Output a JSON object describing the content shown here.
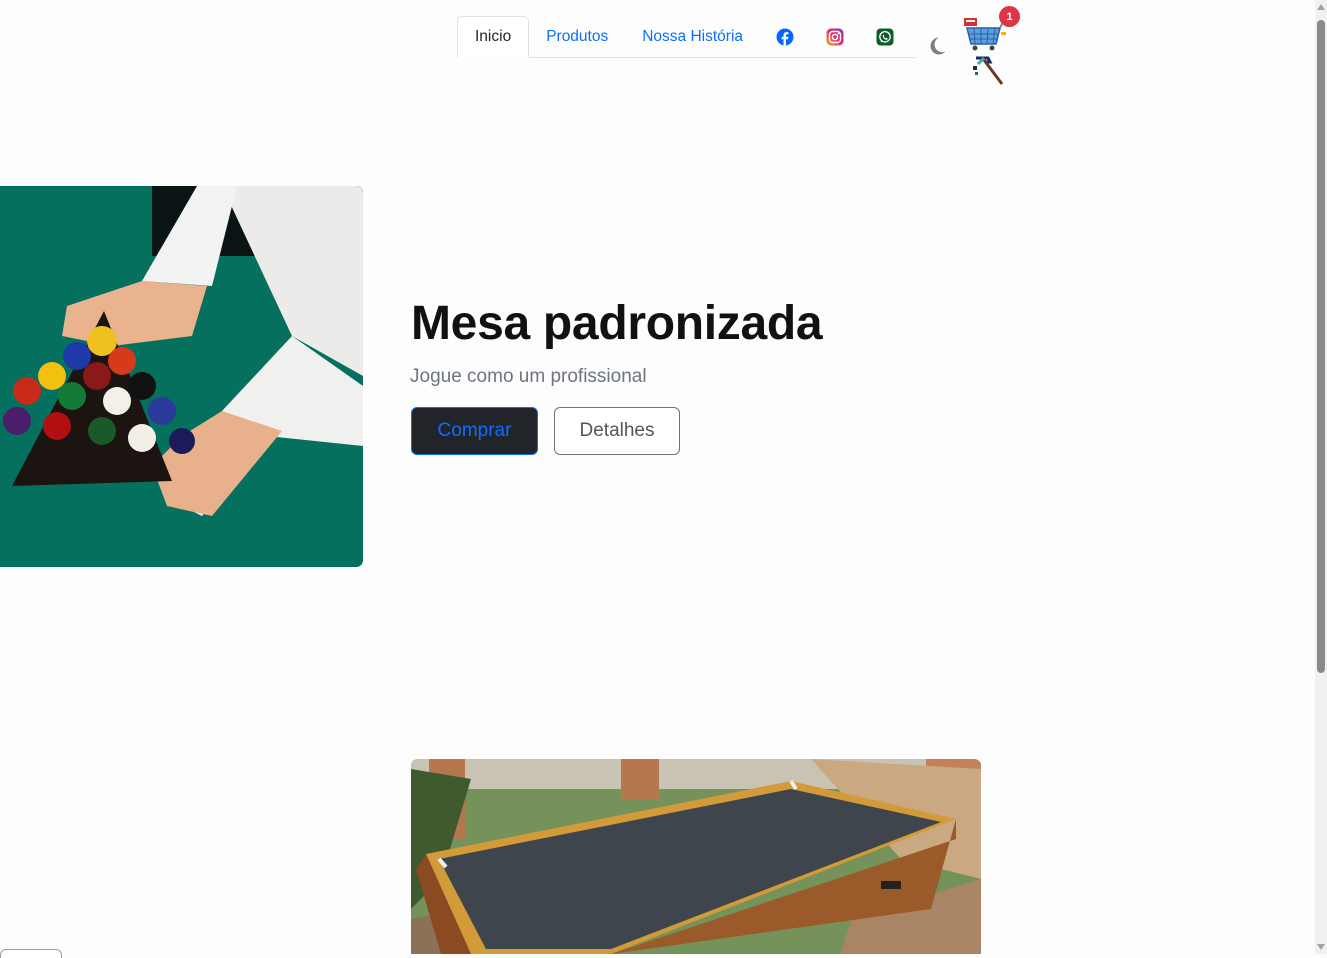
{
  "nav": {
    "tabs": [
      {
        "label": "Inicio",
        "active": true
      },
      {
        "label": "Produtos",
        "active": false
      },
      {
        "label": "Nossa História",
        "active": false
      }
    ],
    "social_icons": [
      "facebook-icon",
      "instagram-icon",
      "whatsapp-icon"
    ],
    "theme_toggle_icon": "moon-icon",
    "cart": {
      "icon": "shopping-cart-icon",
      "badge_count": "1"
    }
  },
  "hero": {
    "title": "Mesa padronizada",
    "subtitle": "Jogue como um profissional",
    "buy_button": "Comprar",
    "details_button": "Detalhes",
    "image": "billiard-rack-photo"
  },
  "product": {
    "image": "pool-table-photo"
  },
  "colors": {
    "primary": "#0d6efd",
    "dark": "#212529",
    "felt_green": "#06705f",
    "badge_red": "#dc3545"
  }
}
